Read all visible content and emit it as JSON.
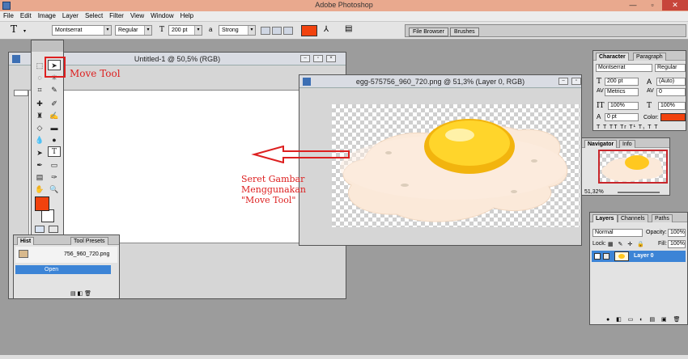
{
  "app": {
    "title": "Adobe Photoshop"
  },
  "menu": [
    "File",
    "Edit",
    "Image",
    "Layer",
    "Select",
    "Filter",
    "View",
    "Window",
    "Help"
  ],
  "options": {
    "font_family": "Montserrat",
    "font_style": "Regular",
    "font_size": "200 pt",
    "aa_label": "a",
    "antialias": "Strong",
    "text_color": "#f1420e"
  },
  "well": {
    "tabs": [
      "File Browser",
      "Brushes"
    ]
  },
  "doc1": {
    "title": "Untitled-1 @ 50,5% (RGB)"
  },
  "doc2": {
    "title": "egg-575756_960_720.png @ 51,3% (Layer 0, RGB)"
  },
  "annotations": {
    "move_tool": "Move Tool",
    "instruction_lines": [
      "Seret Gambar",
      "Menggunakan",
      "\"Move Tool\""
    ]
  },
  "history": {
    "tabs": [
      "Hist",
      "Tool Presets"
    ],
    "snapshot": "756_960_720.png",
    "items": [
      "Open"
    ]
  },
  "character": {
    "tabs": [
      "Character",
      "Paragraph"
    ],
    "font_family": "Montserrat",
    "font_style": "Regular",
    "size": "200 pt",
    "leading": "(Auto)",
    "kerning": "Metrics",
    "tracking": "0",
    "vscale": "100%",
    "hscale": "100%",
    "baseline": "0 pt",
    "color_label": "Color:",
    "color": "#f1420e"
  },
  "navigator": {
    "tabs": [
      "Navigator",
      "Info"
    ],
    "zoom": "51,32%"
  },
  "layers": {
    "tabs": [
      "Layers",
      "Channels",
      "Paths"
    ],
    "blend_mode": "Normal",
    "opacity_label": "Opacity:",
    "opacity": "100%",
    "lock_label": "Lock:",
    "fill_label": "Fill:",
    "fill": "100%",
    "items": [
      "Layer 0"
    ]
  }
}
